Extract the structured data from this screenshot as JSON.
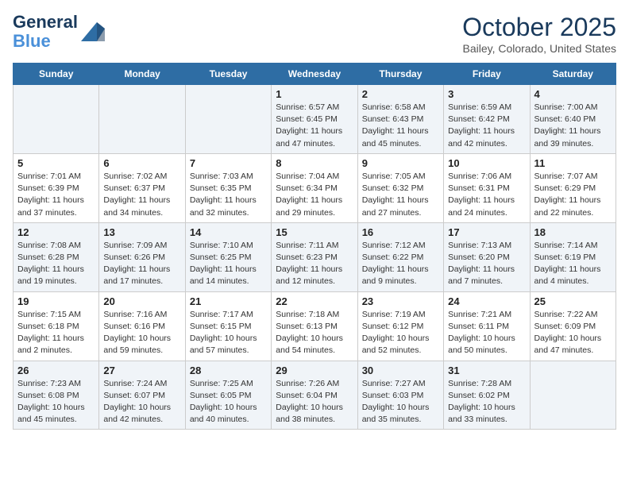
{
  "header": {
    "logo_line1": "General",
    "logo_line2": "Blue",
    "month": "October 2025",
    "location": "Bailey, Colorado, United States"
  },
  "weekdays": [
    "Sunday",
    "Monday",
    "Tuesday",
    "Wednesday",
    "Thursday",
    "Friday",
    "Saturday"
  ],
  "weeks": [
    [
      {
        "day": "",
        "sunrise": "",
        "sunset": "",
        "daylight": ""
      },
      {
        "day": "",
        "sunrise": "",
        "sunset": "",
        "daylight": ""
      },
      {
        "day": "",
        "sunrise": "",
        "sunset": "",
        "daylight": ""
      },
      {
        "day": "1",
        "sunrise": "6:57 AM",
        "sunset": "6:45 PM",
        "daylight": "11 hours and 47 minutes."
      },
      {
        "day": "2",
        "sunrise": "6:58 AM",
        "sunset": "6:43 PM",
        "daylight": "11 hours and 45 minutes."
      },
      {
        "day": "3",
        "sunrise": "6:59 AM",
        "sunset": "6:42 PM",
        "daylight": "11 hours and 42 minutes."
      },
      {
        "day": "4",
        "sunrise": "7:00 AM",
        "sunset": "6:40 PM",
        "daylight": "11 hours and 39 minutes."
      }
    ],
    [
      {
        "day": "5",
        "sunrise": "7:01 AM",
        "sunset": "6:39 PM",
        "daylight": "11 hours and 37 minutes."
      },
      {
        "day": "6",
        "sunrise": "7:02 AM",
        "sunset": "6:37 PM",
        "daylight": "11 hours and 34 minutes."
      },
      {
        "day": "7",
        "sunrise": "7:03 AM",
        "sunset": "6:35 PM",
        "daylight": "11 hours and 32 minutes."
      },
      {
        "day": "8",
        "sunrise": "7:04 AM",
        "sunset": "6:34 PM",
        "daylight": "11 hours and 29 minutes."
      },
      {
        "day": "9",
        "sunrise": "7:05 AM",
        "sunset": "6:32 PM",
        "daylight": "11 hours and 27 minutes."
      },
      {
        "day": "10",
        "sunrise": "7:06 AM",
        "sunset": "6:31 PM",
        "daylight": "11 hours and 24 minutes."
      },
      {
        "day": "11",
        "sunrise": "7:07 AM",
        "sunset": "6:29 PM",
        "daylight": "11 hours and 22 minutes."
      }
    ],
    [
      {
        "day": "12",
        "sunrise": "7:08 AM",
        "sunset": "6:28 PM",
        "daylight": "11 hours and 19 minutes."
      },
      {
        "day": "13",
        "sunrise": "7:09 AM",
        "sunset": "6:26 PM",
        "daylight": "11 hours and 17 minutes."
      },
      {
        "day": "14",
        "sunrise": "7:10 AM",
        "sunset": "6:25 PM",
        "daylight": "11 hours and 14 minutes."
      },
      {
        "day": "15",
        "sunrise": "7:11 AM",
        "sunset": "6:23 PM",
        "daylight": "11 hours and 12 minutes."
      },
      {
        "day": "16",
        "sunrise": "7:12 AM",
        "sunset": "6:22 PM",
        "daylight": "11 hours and 9 minutes."
      },
      {
        "day": "17",
        "sunrise": "7:13 AM",
        "sunset": "6:20 PM",
        "daylight": "11 hours and 7 minutes."
      },
      {
        "day": "18",
        "sunrise": "7:14 AM",
        "sunset": "6:19 PM",
        "daylight": "11 hours and 4 minutes."
      }
    ],
    [
      {
        "day": "19",
        "sunrise": "7:15 AM",
        "sunset": "6:18 PM",
        "daylight": "11 hours and 2 minutes."
      },
      {
        "day": "20",
        "sunrise": "7:16 AM",
        "sunset": "6:16 PM",
        "daylight": "10 hours and 59 minutes."
      },
      {
        "day": "21",
        "sunrise": "7:17 AM",
        "sunset": "6:15 PM",
        "daylight": "10 hours and 57 minutes."
      },
      {
        "day": "22",
        "sunrise": "7:18 AM",
        "sunset": "6:13 PM",
        "daylight": "10 hours and 54 minutes."
      },
      {
        "day": "23",
        "sunrise": "7:19 AM",
        "sunset": "6:12 PM",
        "daylight": "10 hours and 52 minutes."
      },
      {
        "day": "24",
        "sunrise": "7:21 AM",
        "sunset": "6:11 PM",
        "daylight": "10 hours and 50 minutes."
      },
      {
        "day": "25",
        "sunrise": "7:22 AM",
        "sunset": "6:09 PM",
        "daylight": "10 hours and 47 minutes."
      }
    ],
    [
      {
        "day": "26",
        "sunrise": "7:23 AM",
        "sunset": "6:08 PM",
        "daylight": "10 hours and 45 minutes."
      },
      {
        "day": "27",
        "sunrise": "7:24 AM",
        "sunset": "6:07 PM",
        "daylight": "10 hours and 42 minutes."
      },
      {
        "day": "28",
        "sunrise": "7:25 AM",
        "sunset": "6:05 PM",
        "daylight": "10 hours and 40 minutes."
      },
      {
        "day": "29",
        "sunrise": "7:26 AM",
        "sunset": "6:04 PM",
        "daylight": "10 hours and 38 minutes."
      },
      {
        "day": "30",
        "sunrise": "7:27 AM",
        "sunset": "6:03 PM",
        "daylight": "10 hours and 35 minutes."
      },
      {
        "day": "31",
        "sunrise": "7:28 AM",
        "sunset": "6:02 PM",
        "daylight": "10 hours and 33 minutes."
      },
      {
        "day": "",
        "sunrise": "",
        "sunset": "",
        "daylight": ""
      }
    ]
  ],
  "labels": {
    "sunrise_prefix": "Sunrise: ",
    "sunset_prefix": "Sunset: ",
    "daylight_prefix": "Daylight: "
  }
}
